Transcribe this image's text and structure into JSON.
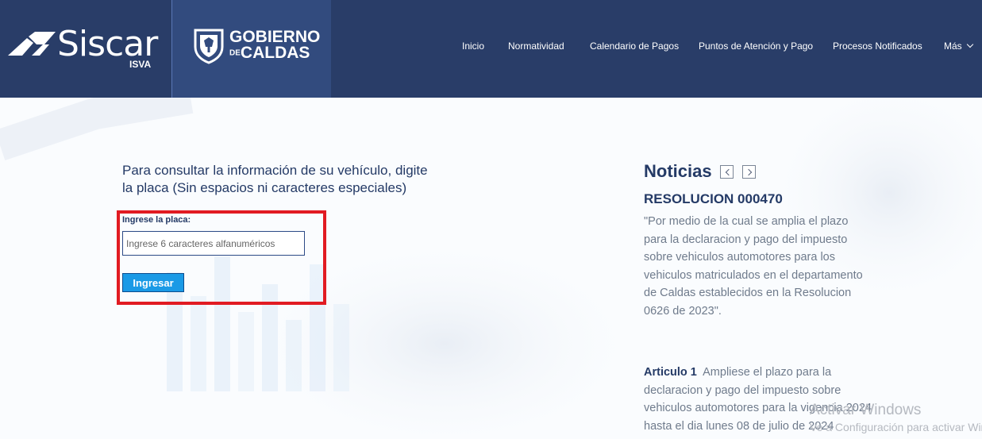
{
  "brand": {
    "name": "Siscar",
    "sub": "ISVA",
    "partner_line1": "GOBIERNO",
    "partner_prefix": "DE",
    "partner_line2": "CALDAS"
  },
  "nav": {
    "items": [
      "Inicio",
      "Normatividad",
      "Calendario de Pagos",
      "Puntos de Atención y Pago",
      "Procesos Notificados"
    ],
    "more": "Más"
  },
  "form": {
    "prompt": "Para consultar la información de su vehículo, digite la placa (Sin espacios ni caracteres especiales)",
    "label": "Ingrese la placa:",
    "placeholder": "Ingrese 6 caracteres alfanuméricos",
    "submit": "Ingresar"
  },
  "news": {
    "title": "Noticias",
    "headline": "RESOLUCION 000470",
    "body": "\"Por medio de la cual se amplia el plazo para la declaracion y pago del impuesto sobre vehiculos automotores para los vehiculos matriculados en el departamento de Caldas establecidos en la Resolucion 0626 de 2023\".",
    "article_label": "Articulo 1",
    "article_text": "Ampliese el plazo para la declaracion y pago del impuesto sobre vehiculos automotores para la vigencia 2024 hasta el dia lunes 08 de julio de 2024"
  },
  "watermark": {
    "line1": "Activar Windows",
    "line2": "Ve a Configuración para activar Windows."
  },
  "colors": {
    "header_bg": "#293d68",
    "accent_blue": "#1a9ae6",
    "highlight_red": "#e11b22",
    "heading": "#243a66"
  }
}
